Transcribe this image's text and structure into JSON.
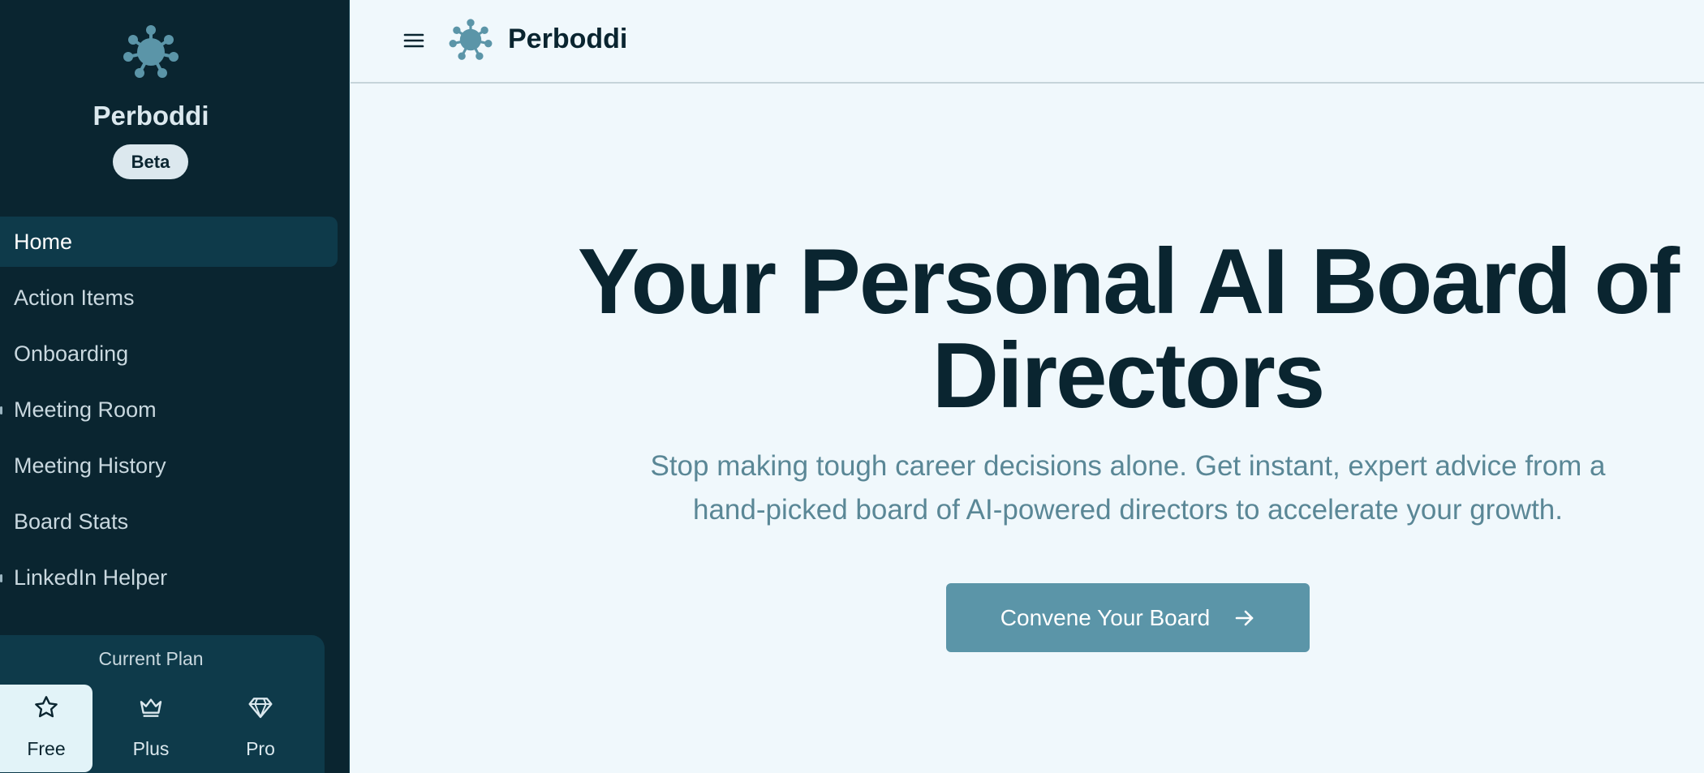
{
  "app": {
    "name": "Perboddi",
    "badge": "Beta"
  },
  "sidebar": {
    "items": [
      {
        "label": "Home",
        "active": true
      },
      {
        "label": "Action Items",
        "active": false
      },
      {
        "label": "Onboarding",
        "active": false
      },
      {
        "label": "Meeting Room",
        "active": false
      },
      {
        "label": "Meeting History",
        "active": false
      },
      {
        "label": "Board Stats",
        "active": false
      },
      {
        "label": "LinkedIn Helper",
        "active": false
      }
    ],
    "plan": {
      "title": "Current Plan",
      "options": [
        {
          "label": "Free",
          "icon": "star-icon",
          "selected": true
        },
        {
          "label": "Plus",
          "icon": "crown-icon",
          "selected": false
        },
        {
          "label": "Pro",
          "icon": "diamond-icon",
          "selected": false
        }
      ]
    }
  },
  "topbar": {
    "title": "Perboddi",
    "menu_icon": "hamburger-menu-icon"
  },
  "hero": {
    "title_line1": "Your Personal AI Board of",
    "title_line2": "Directors",
    "subtitle_line1": "Stop making tough career decisions alone. Get instant, expert advice from a",
    "subtitle_line2": "hand-picked board of AI-powered directors to accelerate your growth.",
    "cta_label": "Convene Your Board"
  },
  "colors": {
    "sidebar_bg": "#0a2530",
    "sidebar_active": "#0e3a4a",
    "page_bg": "#f0f8fc",
    "accent": "#5b95a8",
    "heading": "#0a2530",
    "subtext": "#5a8796"
  }
}
